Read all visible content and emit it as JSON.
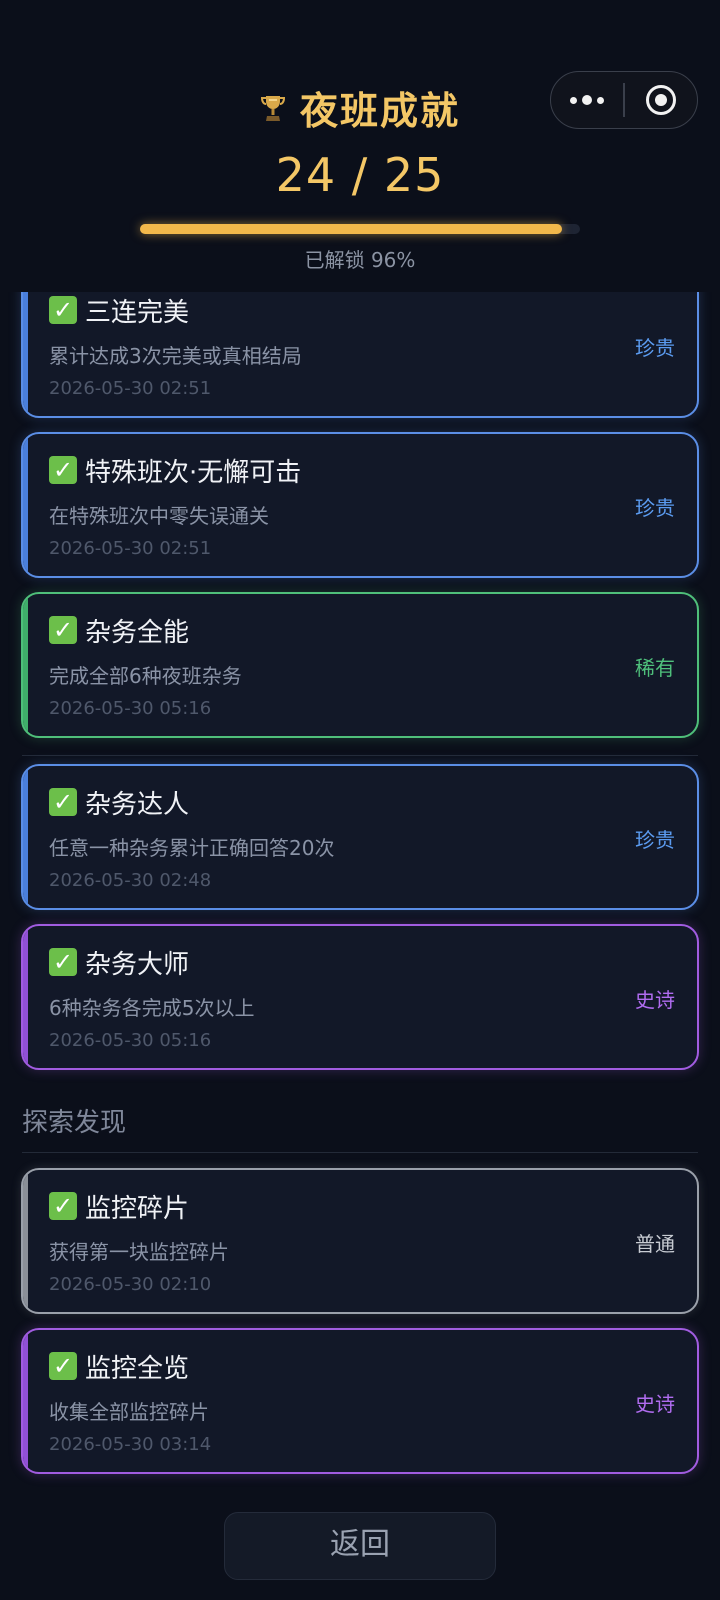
{
  "header": {
    "title": "夜班成就",
    "count": "24 / 25",
    "progress": 0.96,
    "unlock_text": "已解锁 96%",
    "accent_color": "#f4c766"
  },
  "capsule": {
    "more_icon": "more-dots-icon",
    "close_icon": "target-circle-icon"
  },
  "cards": [
    {
      "name": "三连完美",
      "desc": "累计达成3次完美或真相结局",
      "date": "2026-05-30 02:51",
      "rarity": "珍贵",
      "color": "blue"
    },
    {
      "name": "特殊班次·无懈可击",
      "desc": "在特殊班次中零失误通关",
      "date": "2026-05-30 02:51",
      "rarity": "珍贵",
      "color": "blue"
    },
    {
      "name": "杂务全能",
      "desc": "完成全部6种夜班杂务",
      "date": "2026-05-30 05:16",
      "rarity": "稀有",
      "color": "green"
    },
    {
      "name": "杂务达人",
      "desc": "任意一种杂务累计正确回答20次",
      "date": "2026-05-30 02:48",
      "rarity": "珍贵",
      "color": "blue"
    },
    {
      "name": "杂务大师",
      "desc": "6种杂务各完成5次以上",
      "date": "2026-05-30 05:16",
      "rarity": "史诗",
      "color": "purple"
    },
    {
      "name": "监控碎片",
      "desc": "获得第一块监控碎片",
      "date": "2026-05-30 02:10",
      "rarity": "普通",
      "color": "gray"
    },
    {
      "name": "监控全览",
      "desc": "收集全部监控碎片",
      "date": "2026-05-30 03:14",
      "rarity": "史诗",
      "color": "purple"
    }
  ],
  "sections": {
    "explore_title": "探索发现"
  },
  "footer": {
    "back_label": "返回"
  },
  "check_mark": "✓"
}
